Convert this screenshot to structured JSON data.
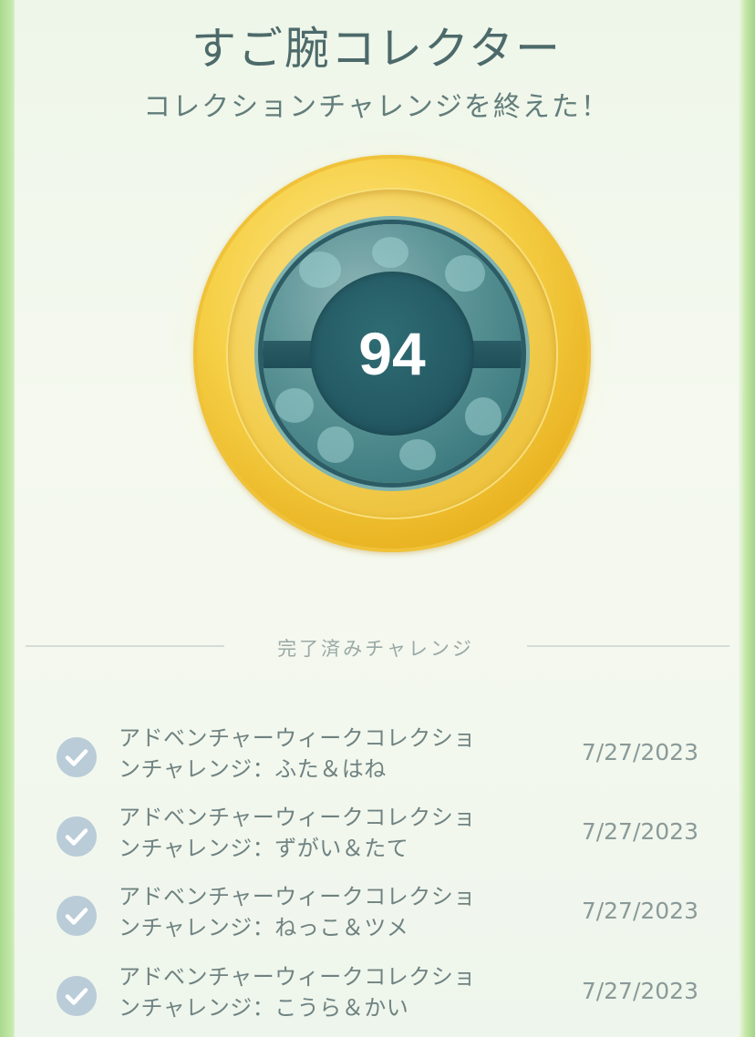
{
  "header": {
    "title": "すご腕コレクター",
    "subtitle": "コレクションチャレンジを終えた！"
  },
  "medal": {
    "count": "94",
    "tier": "gold"
  },
  "completed_section": {
    "label": "完了済みチャレンジ"
  },
  "challenges": [
    {
      "title_line1": "アドベンチャーウィークコレクショ",
      "title_line2": "ンチャレンジ：ふた＆はね",
      "date": "7/27/2023"
    },
    {
      "title_line1": "アドベンチャーウィークコレクショ",
      "title_line2": "ンチャレンジ：ずがい＆たて",
      "date": "7/27/2023"
    },
    {
      "title_line1": "アドベンチャーウィークコレクショ",
      "title_line2": "ンチャレンジ：ねっこ＆ツメ",
      "date": "7/27/2023"
    },
    {
      "title_line1": "アドベンチャーウィークコレクショ",
      "title_line2": "ンチャレンジ：こうら＆かい",
      "date": "7/27/2023"
    }
  ],
  "colors": {
    "title": "#4d6a6a",
    "check_bg": "#b9ccd8",
    "medal_gold": "#f2cd4e",
    "medal_face": "#3f7d82"
  },
  "icons": {
    "check": "checkmark-icon"
  }
}
